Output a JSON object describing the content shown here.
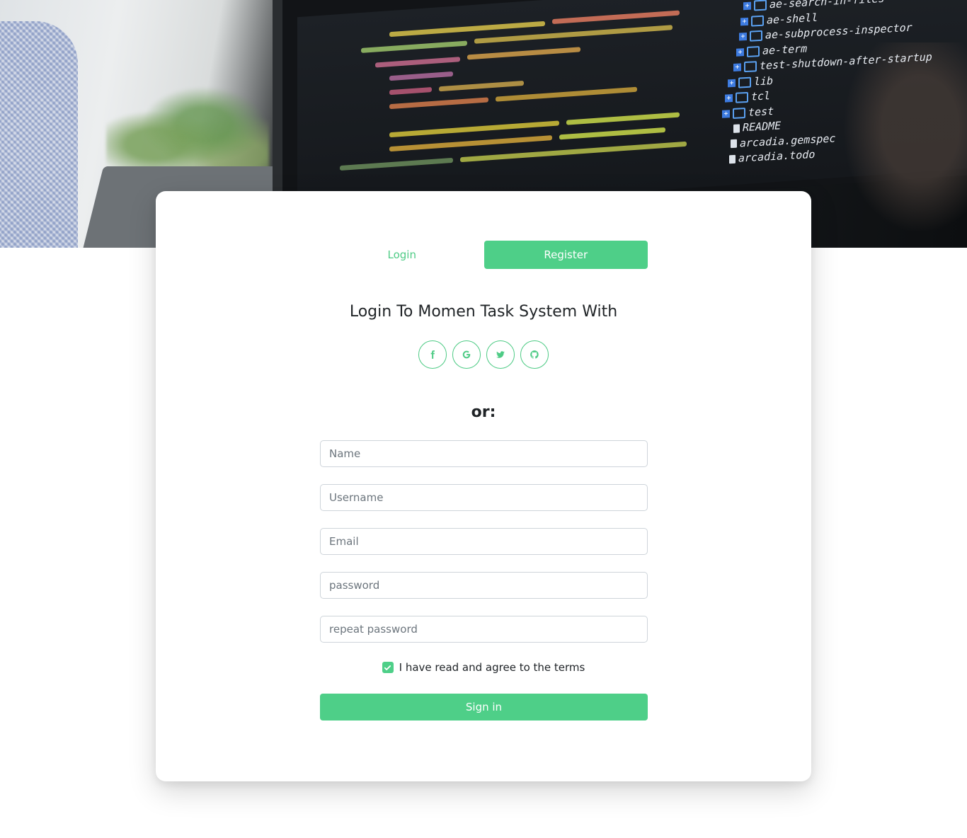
{
  "hero": {
    "file_tree": [
      {
        "type": "folder",
        "name": "ae-search-in-files"
      },
      {
        "type": "folder",
        "name": "ae-shell"
      },
      {
        "type": "folder",
        "name": "ae-subprocess-inspector"
      },
      {
        "type": "folder",
        "name": "ae-term"
      },
      {
        "type": "folder",
        "name": "test-shutdown-after-startup"
      },
      {
        "type": "folder",
        "name": "lib"
      },
      {
        "type": "folder",
        "name": "tcl"
      },
      {
        "type": "folder",
        "name": "test"
      },
      {
        "type": "file",
        "name": "README"
      },
      {
        "type": "file",
        "name": "arcadia.gemspec"
      },
      {
        "type": "file",
        "name": "arcadia.todo"
      }
    ]
  },
  "tabs": {
    "login": "Login",
    "register": "Register",
    "active": "register"
  },
  "title": "Login To Momen Task System With",
  "socials": [
    {
      "icon": "facebook-icon"
    },
    {
      "icon": "google-icon"
    },
    {
      "icon": "twitter-icon"
    },
    {
      "icon": "github-icon"
    }
  ],
  "or_label": "or:",
  "form": {
    "name_placeholder": "Name",
    "username_placeholder": "Username",
    "email_placeholder": "Email",
    "password_placeholder": "password",
    "repeat_password_placeholder": "repeat password",
    "terms_label": "I have read and agree to the terms",
    "terms_checked": true,
    "submit_label": "Sign in"
  },
  "colors": {
    "accent": "#4ecf88",
    "accent_text": "#4ecb85",
    "input_border": "#ced4da"
  }
}
